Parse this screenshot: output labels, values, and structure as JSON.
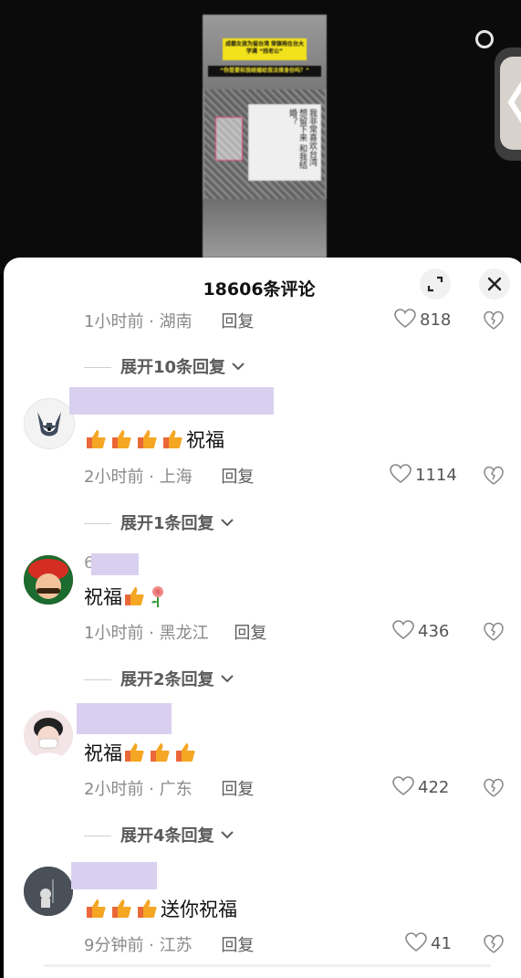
{
  "video": {
    "headline": "成都女孩为留台湾 穿旗袍在台大学满 “找老公”",
    "subhead": "“你是要和我结婚给我法律身份吗？”",
    "paper_text": "我非常喜欢台湾 想留下来 和我结婚？"
  },
  "sheet": {
    "title": "18606条评论"
  },
  "comments": [
    {
      "time": "1小时前",
      "location": "湖南",
      "reply": "回复",
      "likes": "818",
      "expand": "展开10条回复"
    },
    {
      "name_visible": "",
      "text": "祝福",
      "emoji_count": 4,
      "time": "2小时前",
      "location": "上海",
      "reply": "回复",
      "likes": "1114",
      "expand": "展开1条回复"
    },
    {
      "name_prefix": "6",
      "text": "祝福",
      "time": "1小时前",
      "location": "黑龙江",
      "reply": "回复",
      "likes": "436",
      "expand": "展开2条回复"
    },
    {
      "text": "祝福",
      "emoji_count": 3,
      "time": "2小时前",
      "location": "广东",
      "reply": "回复",
      "likes": "422",
      "expand": "展开4条回复"
    },
    {
      "text": "送你祝福",
      "emoji_count": 3,
      "time": "9分钟前",
      "location": "江苏",
      "reply": "回复",
      "likes": "41"
    }
  ],
  "colors": {
    "sheet_bg": "#ffffff",
    "name_redaction": "#d9d0f0",
    "meta_gray": "#8a8a8a"
  }
}
